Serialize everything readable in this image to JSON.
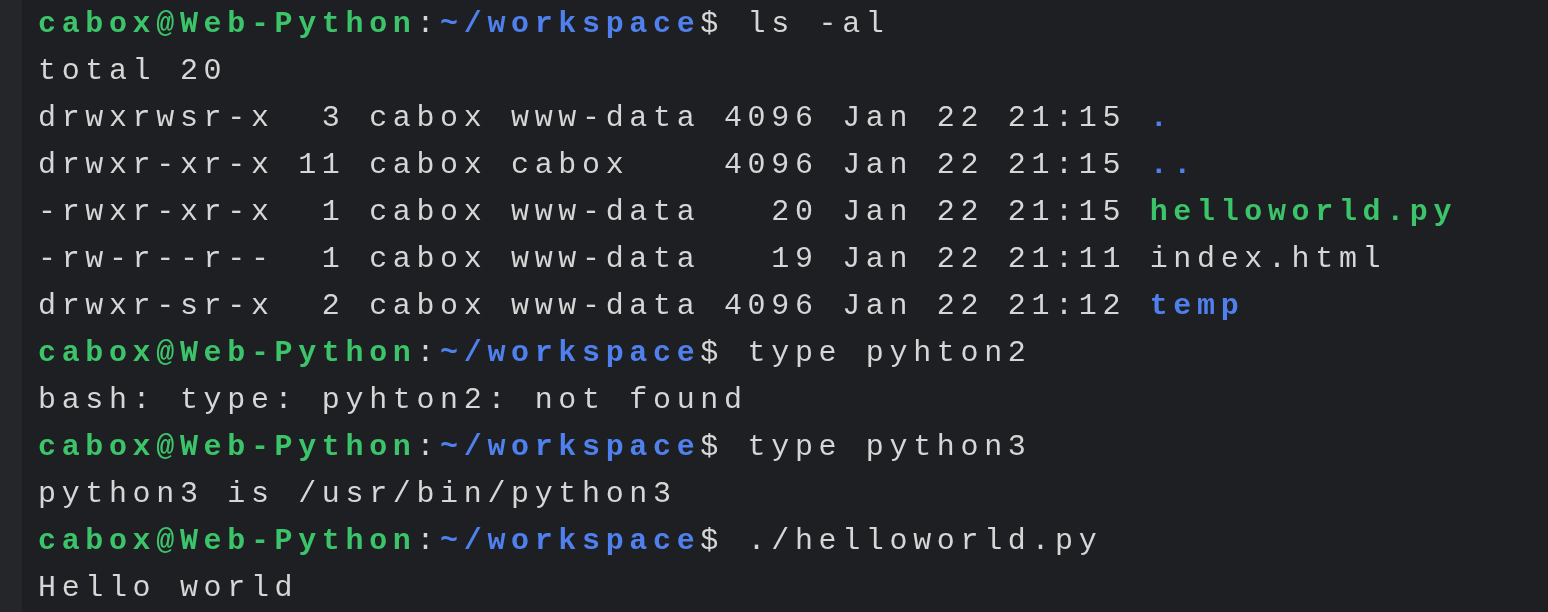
{
  "terminal": {
    "lines": [
      {
        "segments": [
          {
            "kind": "user",
            "text": "cabox@Web-Python"
          },
          {
            "kind": "plain",
            "text": ":"
          },
          {
            "kind": "path",
            "text": "~/workspace"
          },
          {
            "kind": "plain",
            "text": "$ ls -al"
          }
        ]
      },
      {
        "segments": [
          {
            "kind": "plain",
            "text": "total 20"
          }
        ]
      },
      {
        "segments": [
          {
            "kind": "plain",
            "text": "drwxrwsr-x  3 cabox www-data 4096 Jan 22 21:15 "
          },
          {
            "kind": "dir",
            "text": "."
          }
        ]
      },
      {
        "segments": [
          {
            "kind": "plain",
            "text": "drwxr-xr-x 11 cabox cabox    4096 Jan 22 21:15 "
          },
          {
            "kind": "dir",
            "text": ".."
          }
        ]
      },
      {
        "segments": [
          {
            "kind": "plain",
            "text": "-rwxr-xr-x  1 cabox www-data   20 Jan 22 21:15 "
          },
          {
            "kind": "exec",
            "text": "helloworld.py"
          }
        ]
      },
      {
        "segments": [
          {
            "kind": "plain",
            "text": "-rw-r--r--  1 cabox www-data   19 Jan 22 21:11 "
          },
          {
            "kind": "file",
            "text": "index.html"
          }
        ]
      },
      {
        "segments": [
          {
            "kind": "plain",
            "text": "drwxr-sr-x  2 cabox www-data 4096 Jan 22 21:12 "
          },
          {
            "kind": "dir",
            "text": "temp"
          }
        ]
      },
      {
        "segments": [
          {
            "kind": "user",
            "text": "cabox@Web-Python"
          },
          {
            "kind": "plain",
            "text": ":"
          },
          {
            "kind": "path",
            "text": "~/workspace"
          },
          {
            "kind": "plain",
            "text": "$ type pyhton2"
          }
        ]
      },
      {
        "segments": [
          {
            "kind": "plain",
            "text": "bash: type: pyhton2: not found"
          }
        ]
      },
      {
        "segments": [
          {
            "kind": "user",
            "text": "cabox@Web-Python"
          },
          {
            "kind": "plain",
            "text": ":"
          },
          {
            "kind": "path",
            "text": "~/workspace"
          },
          {
            "kind": "plain",
            "text": "$ type python3"
          }
        ]
      },
      {
        "segments": [
          {
            "kind": "plain",
            "text": "python3 is /usr/bin/python3"
          }
        ]
      },
      {
        "segments": [
          {
            "kind": "user",
            "text": "cabox@Web-Python"
          },
          {
            "kind": "plain",
            "text": ":"
          },
          {
            "kind": "path",
            "text": "~/workspace"
          },
          {
            "kind": "plain",
            "text": "$ ./helloworld.py"
          }
        ]
      },
      {
        "segments": [
          {
            "kind": "plain",
            "text": "Hello world"
          }
        ]
      }
    ]
  }
}
